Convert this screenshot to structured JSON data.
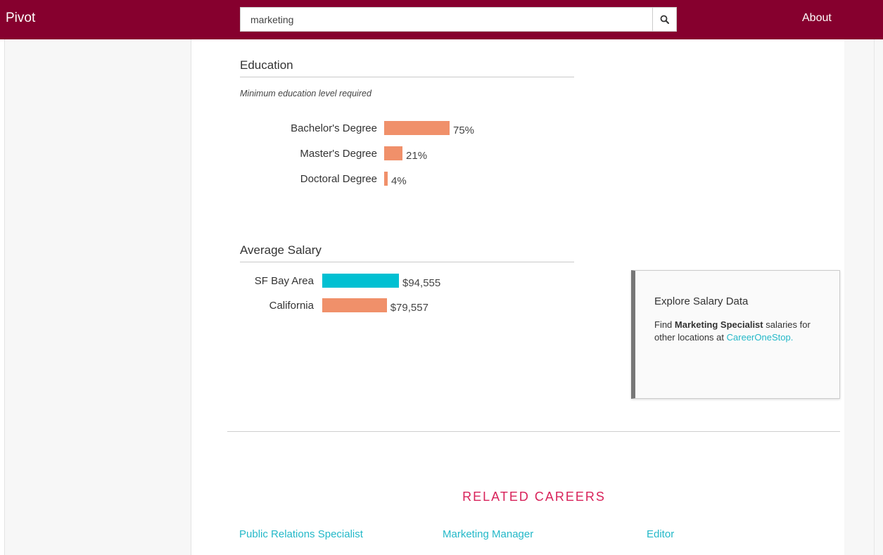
{
  "header": {
    "brand": "Pivot",
    "search": {
      "value": "marketing",
      "placeholder": ""
    },
    "search_icon": "search-icon",
    "about_label": "About",
    "colors": {
      "bar": "#86002e"
    }
  },
  "education": {
    "title": "Education",
    "subtitle": "Minimum education level required",
    "rows": [
      {
        "label": "Bachelor's Degree",
        "value_text": "75%",
        "percent": 75
      },
      {
        "label": "Master's Degree",
        "value_text": "21%",
        "percent": 21
      },
      {
        "label": "Doctoral Degree",
        "value_text": "4%",
        "percent": 4
      }
    ],
    "bar_color": "#f0906a"
  },
  "salary": {
    "title": "Average Salary",
    "rows": [
      {
        "label": "SF Bay Area",
        "value_text": "$94,555",
        "amount": 94555,
        "color": "#00c0d2"
      },
      {
        "label": "California",
        "value_text": "$79,557",
        "amount": 79557,
        "color": "#f0906a"
      }
    ]
  },
  "explore": {
    "title": "Explore Salary Data",
    "text_before": "Find ",
    "career_name": "Marketing Specialist",
    "text_after": " salaries for other locations at",
    "link_label": "CareerOneStop."
  },
  "related": {
    "title": "RELATED CAREERS",
    "links": [
      "Public Relations Specialist",
      "Marketing Manager",
      "Editor"
    ]
  }
}
